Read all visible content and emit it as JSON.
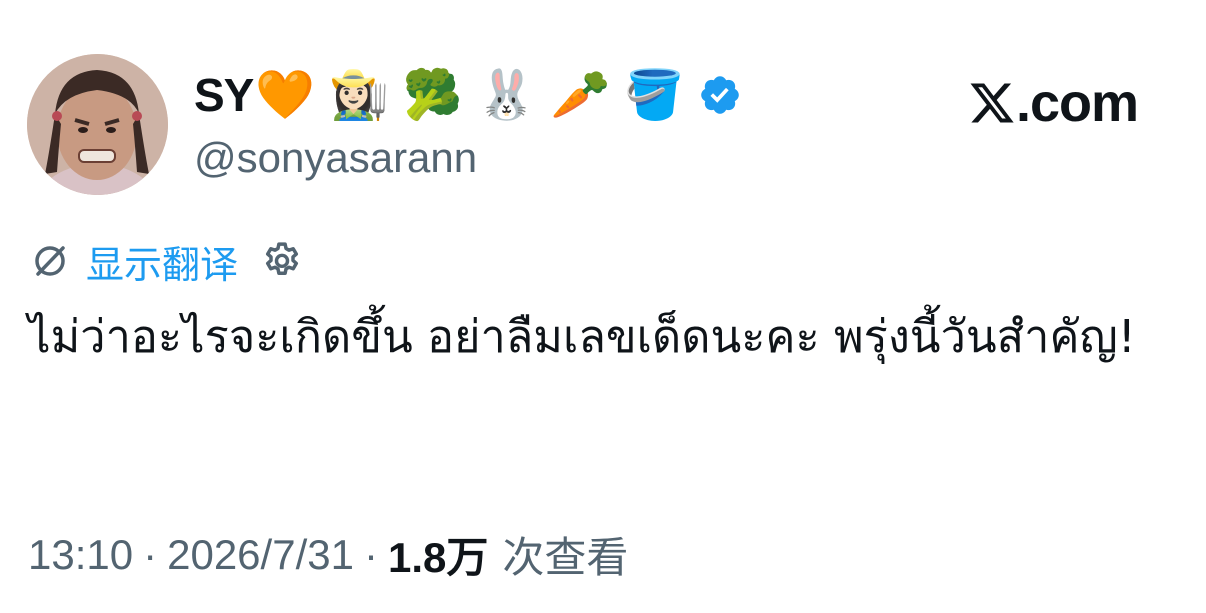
{
  "author": {
    "display_name": "SY",
    "emojis": [
      "🧡",
      "👩🏻‍🌾",
      "🥦",
      "🐰",
      "🥕",
      "🪣"
    ],
    "handle": "@sonyasarann",
    "verified": true
  },
  "brand": {
    "domain": ".com",
    "logo_icon": "x-logo-icon"
  },
  "translate": {
    "label": "显示翻译",
    "icon": "translate-icon",
    "settings_icon": "gear-icon"
  },
  "tweet": {
    "text": "ไม่ว่าอะไรจะเกิดขึ้น อย่าลืมเลขเด็ดนะคะ พรุ่งนี้วันสำคัญ!"
  },
  "meta": {
    "time": "13:10",
    "separator": "·",
    "date": "2026/7/31",
    "views_count": "1.8万",
    "views_label": "次查看"
  },
  "colors": {
    "accent": "#1d9bf0",
    "text": "#0f1419",
    "secondary": "#536471",
    "background": "#ffffff"
  }
}
